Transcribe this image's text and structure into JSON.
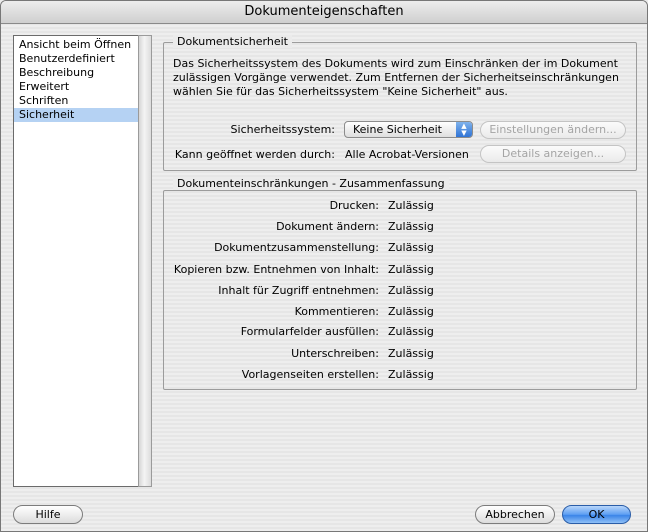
{
  "window": {
    "title": "Dokumenteigenschaften"
  },
  "sidebar": {
    "items": [
      {
        "label": "Ansicht beim Öffnen"
      },
      {
        "label": "Benutzerdefiniert"
      },
      {
        "label": "Beschreibung"
      },
      {
        "label": "Erweitert"
      },
      {
        "label": "Schriften"
      },
      {
        "label": "Sicherheit"
      }
    ],
    "selected": "Sicherheit"
  },
  "security": {
    "title": "Dokumentsicherheit",
    "description": "Das Sicherheitssystem des Dokuments wird zum Einschränken der im Dokument zulässigen Vorgänge verwendet. Zum Entfernen der Sicherheitseinschränkungen wählen Sie für das Sicherheitssystem \"Keine Sicherheit\" aus.",
    "system_label": "Sicherheitssystem:",
    "system_value": "Keine Sicherheit",
    "settings_button": "Einstellungen ändern...",
    "openable_label": "Kann geöffnet werden durch:",
    "openable_value": "Alle Acrobat-Versionen",
    "details_button": "Details anzeigen..."
  },
  "restrictions": {
    "title": "Dokumenteinschränkungen - Zusammenfassung",
    "rows": [
      {
        "label": "Drucken:",
        "value": "Zulässig"
      },
      {
        "label": "Dokument ändern:",
        "value": "Zulässig"
      },
      {
        "label": "Dokumentzusammenstellung:",
        "value": "Zulässig"
      },
      {
        "label": "Kopieren bzw. Entnehmen von Inhalt:",
        "value": "Zulässig"
      },
      {
        "label": "Inhalt für Zugriff entnehmen:",
        "value": "Zulässig"
      },
      {
        "label": "Kommentieren:",
        "value": "Zulässig"
      },
      {
        "label": "Formularfelder ausfüllen:",
        "value": "Zulässig"
      },
      {
        "label": "Unterschreiben:",
        "value": "Zulässig"
      },
      {
        "label": "Vorlagenseiten erstellen:",
        "value": "Zulässig"
      }
    ]
  },
  "footer": {
    "help_button": "Hilfe",
    "cancel_button": "Abbrechen",
    "ok_button": "OK"
  },
  "colors": {
    "selection": "#b5d2f3",
    "default_button": "#5d9ef2"
  }
}
